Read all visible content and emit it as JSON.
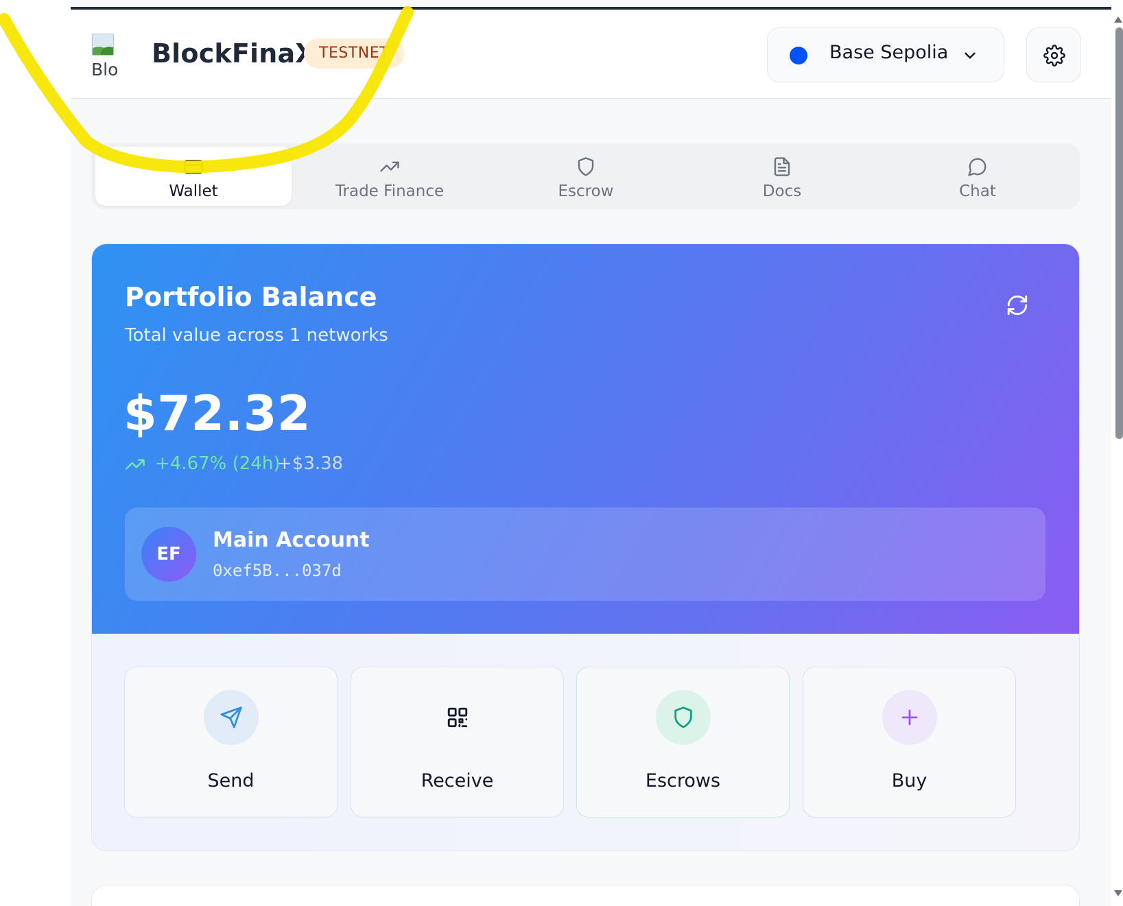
{
  "header": {
    "logo_alt": "Blocl",
    "brand": "BlockFinaX",
    "badge": "TESTNET",
    "network": {
      "label": "Base Sepolia",
      "dot_color": "#0052ff"
    },
    "settings_icon": "gear-icon"
  },
  "tabs": [
    {
      "label": "Wallet",
      "icon": "card-icon",
      "active": true
    },
    {
      "label": "Trade Finance",
      "icon": "trending-up-icon",
      "active": false
    },
    {
      "label": "Escrow",
      "icon": "shield-icon",
      "active": false
    },
    {
      "label": "Docs",
      "icon": "document-icon",
      "active": false
    },
    {
      "label": "Chat",
      "icon": "chat-bubble-icon",
      "active": false
    }
  ],
  "portfolio": {
    "title": "Portfolio Balance",
    "subtitle": "Total value across 1 networks",
    "balance": "$72.32",
    "change_pct": "+4.67% (24h)",
    "change_abs": "+$3.38",
    "account": {
      "initials": "EF",
      "name": "Main Account",
      "address": "0xef5B...037d"
    }
  },
  "actions": [
    {
      "label": "Send",
      "icon": "send-icon",
      "accent": "#2f8fe0"
    },
    {
      "label": "Receive",
      "icon": "qr-code-icon",
      "accent": "#111827"
    },
    {
      "label": "Escrows",
      "icon": "shield-icon",
      "accent": "#10a37f"
    },
    {
      "label": "Buy",
      "icon": "plus-icon",
      "accent": "#9b59e8"
    }
  ],
  "colors": {
    "gradient_start": "#2f92f3",
    "gradient_end": "#8a5cf2",
    "positive": "#6ee7a8",
    "annotation": "#f7e600"
  }
}
